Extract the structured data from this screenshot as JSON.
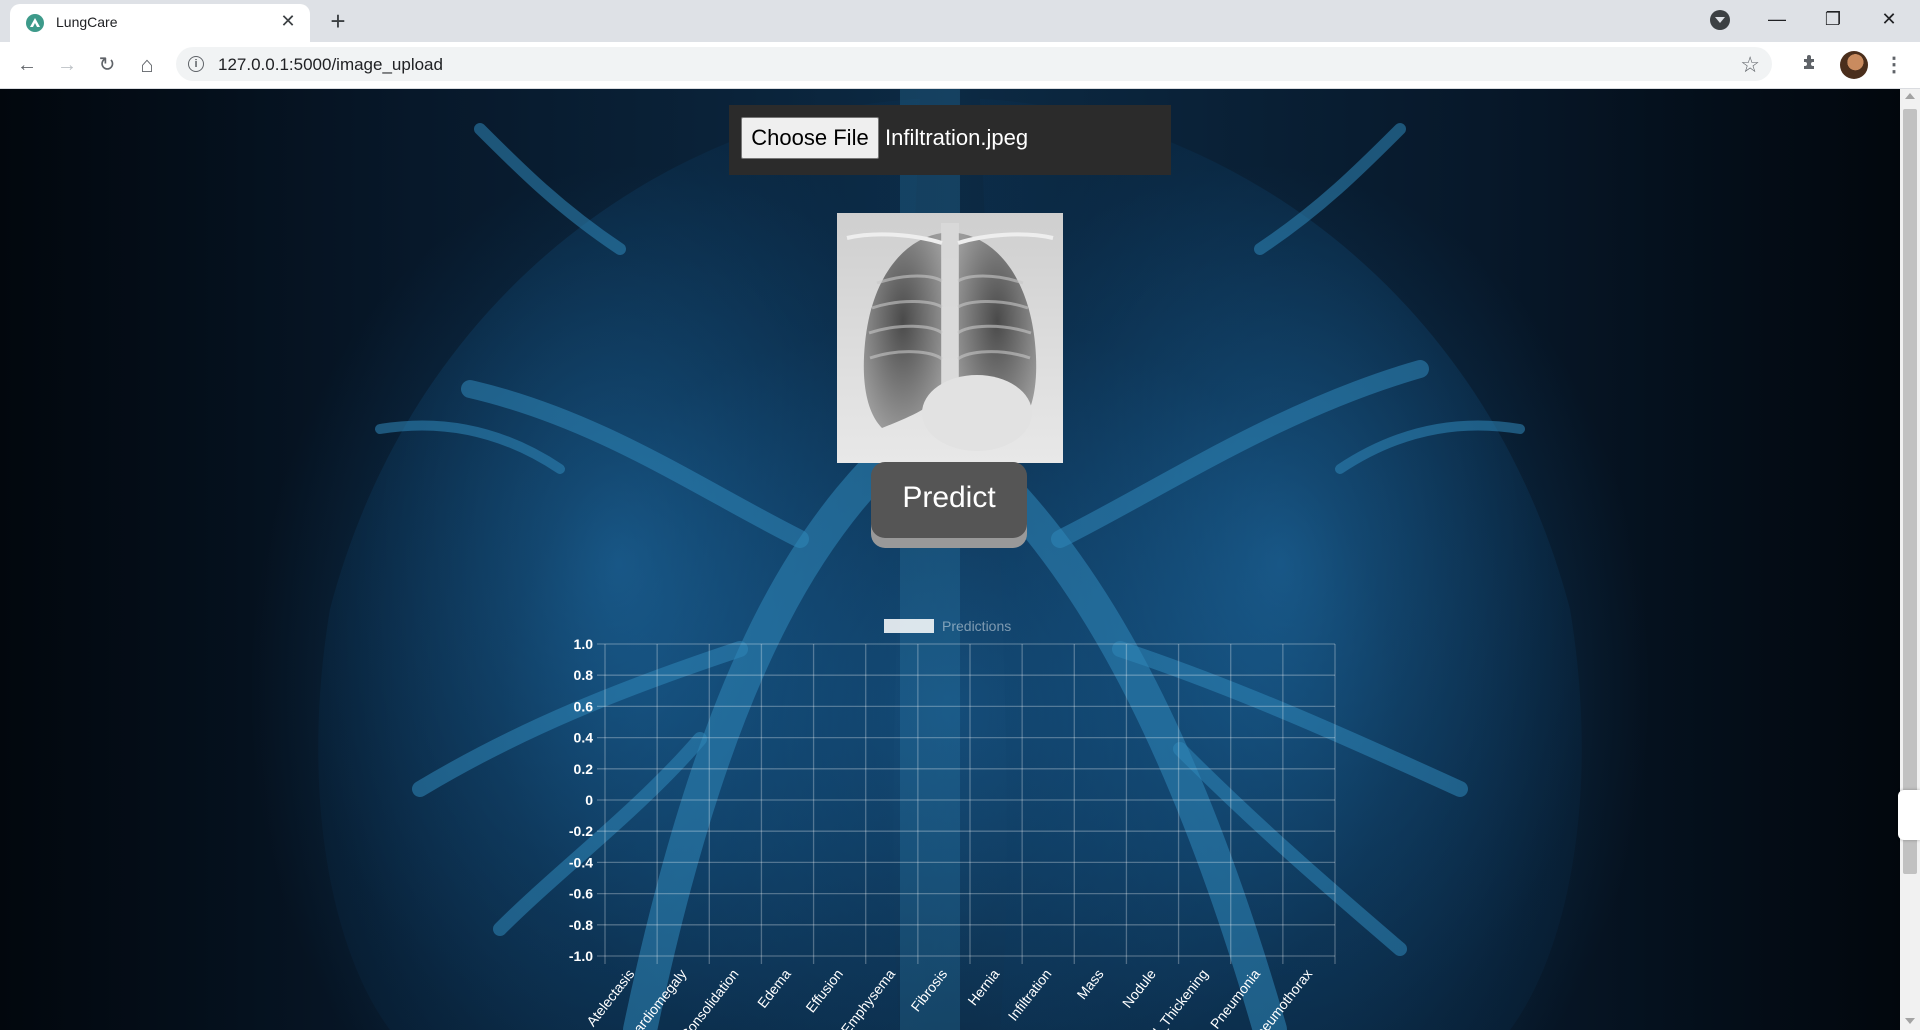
{
  "browser": {
    "tab_title": "LungCare",
    "tab_close_glyph": "✕",
    "new_tab_glyph": "+",
    "url": "127.0.0.1:5000/image_upload",
    "info_glyph": "i",
    "window_controls": {
      "minimize": "—",
      "maximize": "❐",
      "close": "✕"
    },
    "nav": {
      "back": "←",
      "forward": "→",
      "reload": "↻",
      "home": "⌂"
    },
    "icons": [
      "star-icon",
      "extensions-icon",
      "profile-avatar",
      "menu-icon",
      "tab-search-icon"
    ]
  },
  "page": {
    "upload": {
      "button_label": "Choose File",
      "file_name": "Infiltration.jpeg"
    },
    "predict_label": "Predict"
  },
  "chart_data": {
    "type": "bar",
    "legend": [
      {
        "name": "Predictions",
        "color": "#ffffff"
      }
    ],
    "legend_position": "top",
    "categories": [
      "Atelectasis",
      "Cardiomegaly",
      "Consolidation",
      "Edema",
      "Effusion",
      "Emphysema",
      "Fibrosis",
      "Hernia",
      "Infiltration",
      "Mass",
      "Nodule",
      "Pleural_Thickening",
      "Pneumonia",
      "Pneumothorax"
    ],
    "series": [
      {
        "name": "Predictions",
        "values": []
      }
    ],
    "y_ticks": [
      "1.0",
      "0.8",
      "0.6",
      "0.4",
      "0.2",
      "0",
      "-0.2",
      "-0.4",
      "-0.6",
      "-0.8",
      "-1.0"
    ],
    "ylim": [
      -1.0,
      1.0
    ],
    "grid": true,
    "tick_color": "#ffffff",
    "grid_color": "rgba(255,255,255,0.28)"
  }
}
